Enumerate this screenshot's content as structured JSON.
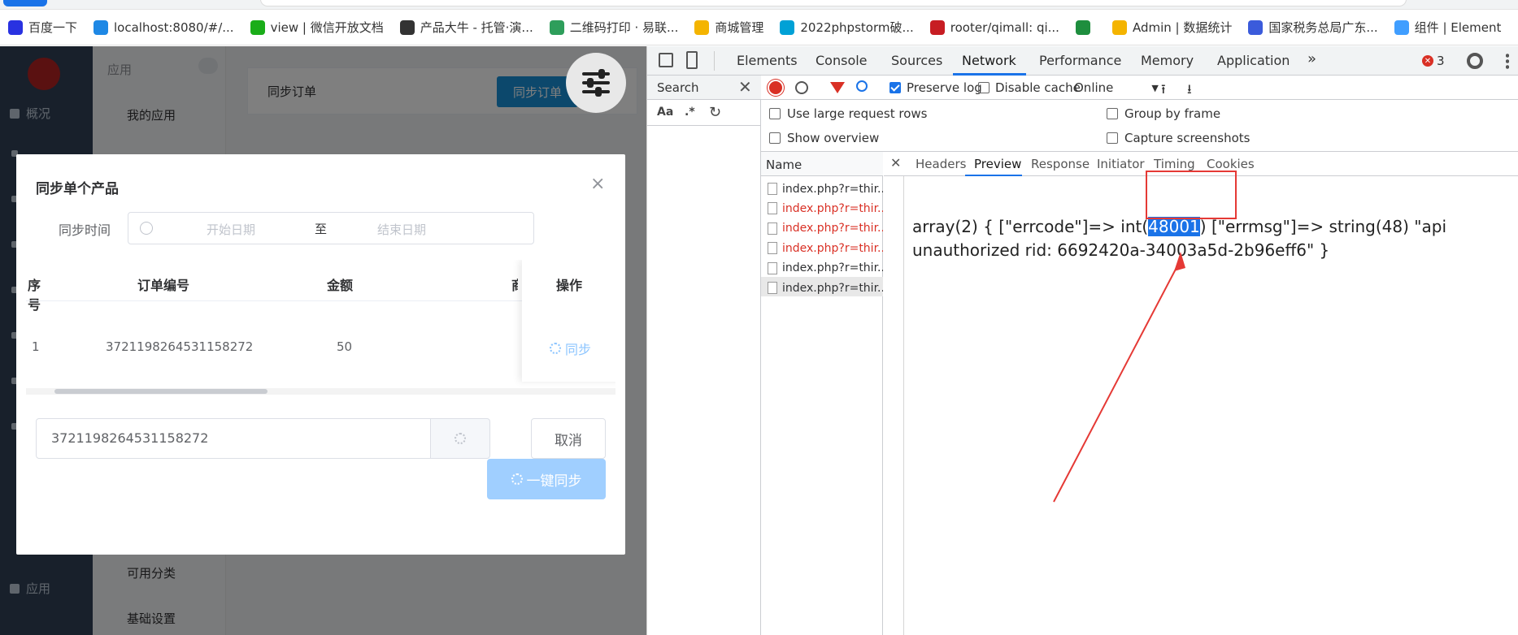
{
  "bookmarks": [
    {
      "label": "百度一下",
      "icon": "baidu-icon",
      "color": "#2932e1"
    },
    {
      "label": "localhost:8080/#/...",
      "icon": "t-icon",
      "color": "#1e88e5"
    },
    {
      "label": "view | 微信开放文档",
      "icon": "wechat-icon",
      "color": "#1aad19"
    },
    {
      "label": "产品大牛 - 托管·演...",
      "icon": "product-icon",
      "color": "#333333"
    },
    {
      "label": "二维码打印 · 易联...",
      "icon": "qrcode-icon",
      "color": "#2e9e5b"
    },
    {
      "label": "商城管理",
      "icon": "grid-icon",
      "color": "#f4b400"
    },
    {
      "label": "2022phpstorm破...",
      "icon": "bilibili-icon",
      "color": "#00a1d6"
    },
    {
      "label": "rooter/qimall: qi...",
      "icon": "gitee-icon",
      "color": "#c71d23"
    },
    {
      "label": "",
      "icon": "table-icon",
      "color": "#1e8e3e"
    },
    {
      "label": "Admin | 数据统计",
      "icon": "grid-icon",
      "color": "#f4b400"
    },
    {
      "label": "国家税务总局广东...",
      "icon": "tax-icon",
      "color": "#3b5bdb"
    },
    {
      "label": "组件 | Element",
      "icon": "element-icon",
      "color": "#409eff"
    }
  ],
  "sidebar": {
    "items": [
      "概况",
      "应用"
    ]
  },
  "submenu": {
    "header": "应用",
    "items": [
      "我的应用",
      "可用分类",
      "基础设置"
    ]
  },
  "page": {
    "card_title": "同步订单",
    "card_button": "同步订单"
  },
  "dialog": {
    "title": "同步单个产品",
    "date_label": "同步时间",
    "start_placeholder": "开始日期",
    "range_sep": "至",
    "end_placeholder": "结束日期",
    "columns": [
      "序号",
      "订单编号",
      "金额",
      "商",
      "操作"
    ],
    "rows": [
      {
        "index": "1",
        "order_no": "3721198264531158272",
        "amount": "50",
        "action": "同步"
      }
    ],
    "input_value": "3721198264531158272",
    "cancel": "取消",
    "sync_all": "一键同步"
  },
  "devtools": {
    "tabs": [
      "Elements",
      "Console",
      "Sources",
      "Network",
      "Performance",
      "Memory",
      "Application"
    ],
    "active_tab": "Network",
    "error_count": "3",
    "search_title": "Search",
    "search_tools": [
      "Aa",
      ".*"
    ],
    "preserve_log": "Preserve log",
    "disable_cache": "Disable cache",
    "throttle": "Online",
    "options": {
      "large_rows": "Use large request rows",
      "overview": "Show overview",
      "group_frame": "Group by frame",
      "capture": "Capture screenshots"
    },
    "name_header": "Name",
    "requests": [
      {
        "name": "index.php?r=thir...",
        "status": "ok"
      },
      {
        "name": "index.php?r=thir...",
        "status": "error"
      },
      {
        "name": "index.php?r=thir...",
        "status": "error"
      },
      {
        "name": "index.php?r=thir...",
        "status": "error"
      },
      {
        "name": "index.php?r=thir...",
        "status": "ok"
      },
      {
        "name": "index.php?r=thir...",
        "status": "selected"
      }
    ],
    "detail_tabs": [
      "Headers",
      "Preview",
      "Response",
      "Initiator",
      "Timing",
      "Cookies"
    ],
    "active_detail_tab": "Preview",
    "preview": {
      "line1_a": "array(2) { [\"errcode\"]=> int(",
      "errcode": "48001",
      "line1_b": ") [\"errmsg\"]=> string(48) \"api",
      "line2": "unauthorized rid: 6692420a-34003a5d-2b96eff6\" }"
    }
  }
}
